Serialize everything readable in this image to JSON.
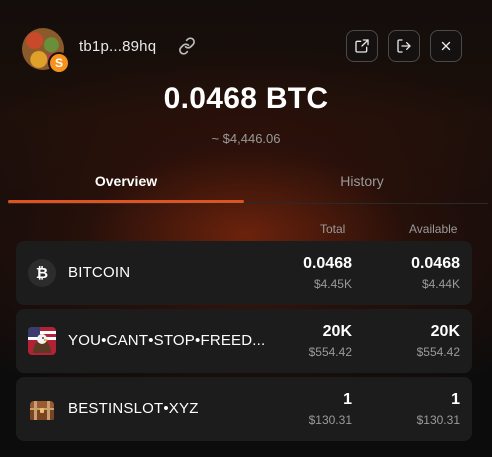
{
  "header": {
    "address": "tb1p...89hq",
    "avatar_badge": "S"
  },
  "balance": {
    "btc": "0.0468 BTC",
    "usd": "~ $4,446.06"
  },
  "tabs": [
    {
      "label": "Overview",
      "active": true
    },
    {
      "label": "History",
      "active": false
    }
  ],
  "columns": {
    "total": "Total",
    "available": "Available"
  },
  "tokens": [
    {
      "name": "BITCOIN",
      "icon": "bitcoin-icon",
      "glyph": "₿",
      "total": "0.0468",
      "total_usd": "$4.45K",
      "available": "0.0468",
      "available_usd": "$4.44K"
    },
    {
      "name": "YOU•CANT•STOP•FREED...",
      "icon": "eagle-flag-icon",
      "total": "20K",
      "total_usd": "$554.42",
      "available": "20K",
      "available_usd": "$554.42"
    },
    {
      "name": "BESTINSLOT•XYZ",
      "icon": "treasure-chest-icon",
      "total": "1",
      "total_usd": "$130.31",
      "available": "1",
      "available_usd": "$130.31"
    }
  ],
  "colors": {
    "accent": "#e0521e",
    "row_bg": "#1c1c1c",
    "muted_text": "#9a9a9a"
  }
}
